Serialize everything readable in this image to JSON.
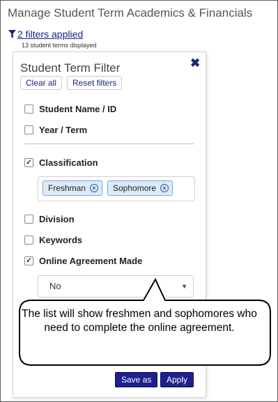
{
  "page": {
    "title": "Manage Student Term Academics & Financials",
    "filters_link": "2 filters applied",
    "count_text": "13 student terms displayed"
  },
  "filter_panel": {
    "title": "Student Term Filter",
    "clear_all": "Clear all",
    "reset_filters": "Reset filters",
    "fields": [
      {
        "label": "Student Name / ID",
        "checked": false
      },
      {
        "label": "Year / Term",
        "checked": false
      },
      {
        "label": "Classification",
        "checked": true
      },
      {
        "label": "Division",
        "checked": false
      },
      {
        "label": "Keywords",
        "checked": false
      },
      {
        "label": "Online Agreement Made",
        "checked": true
      }
    ],
    "classification_tags": [
      "Freshman",
      "Sophomore"
    ],
    "online_agreement_value": "No",
    "save_as": "Save as",
    "apply": "Apply"
  },
  "callout": {
    "text": "The list will show freshmen and sophomores who need to complete the online agreement."
  },
  "icons": {
    "filter": "funnel-icon",
    "close": "close-icon",
    "tag_remove": "circle-x-icon",
    "select": "caret-down-icon"
  },
  "colors": {
    "link": "#1a237e",
    "button_primary": "#1f1f8f",
    "tag_bg": "#dcebf8",
    "tag_border": "#7aa6d6"
  }
}
